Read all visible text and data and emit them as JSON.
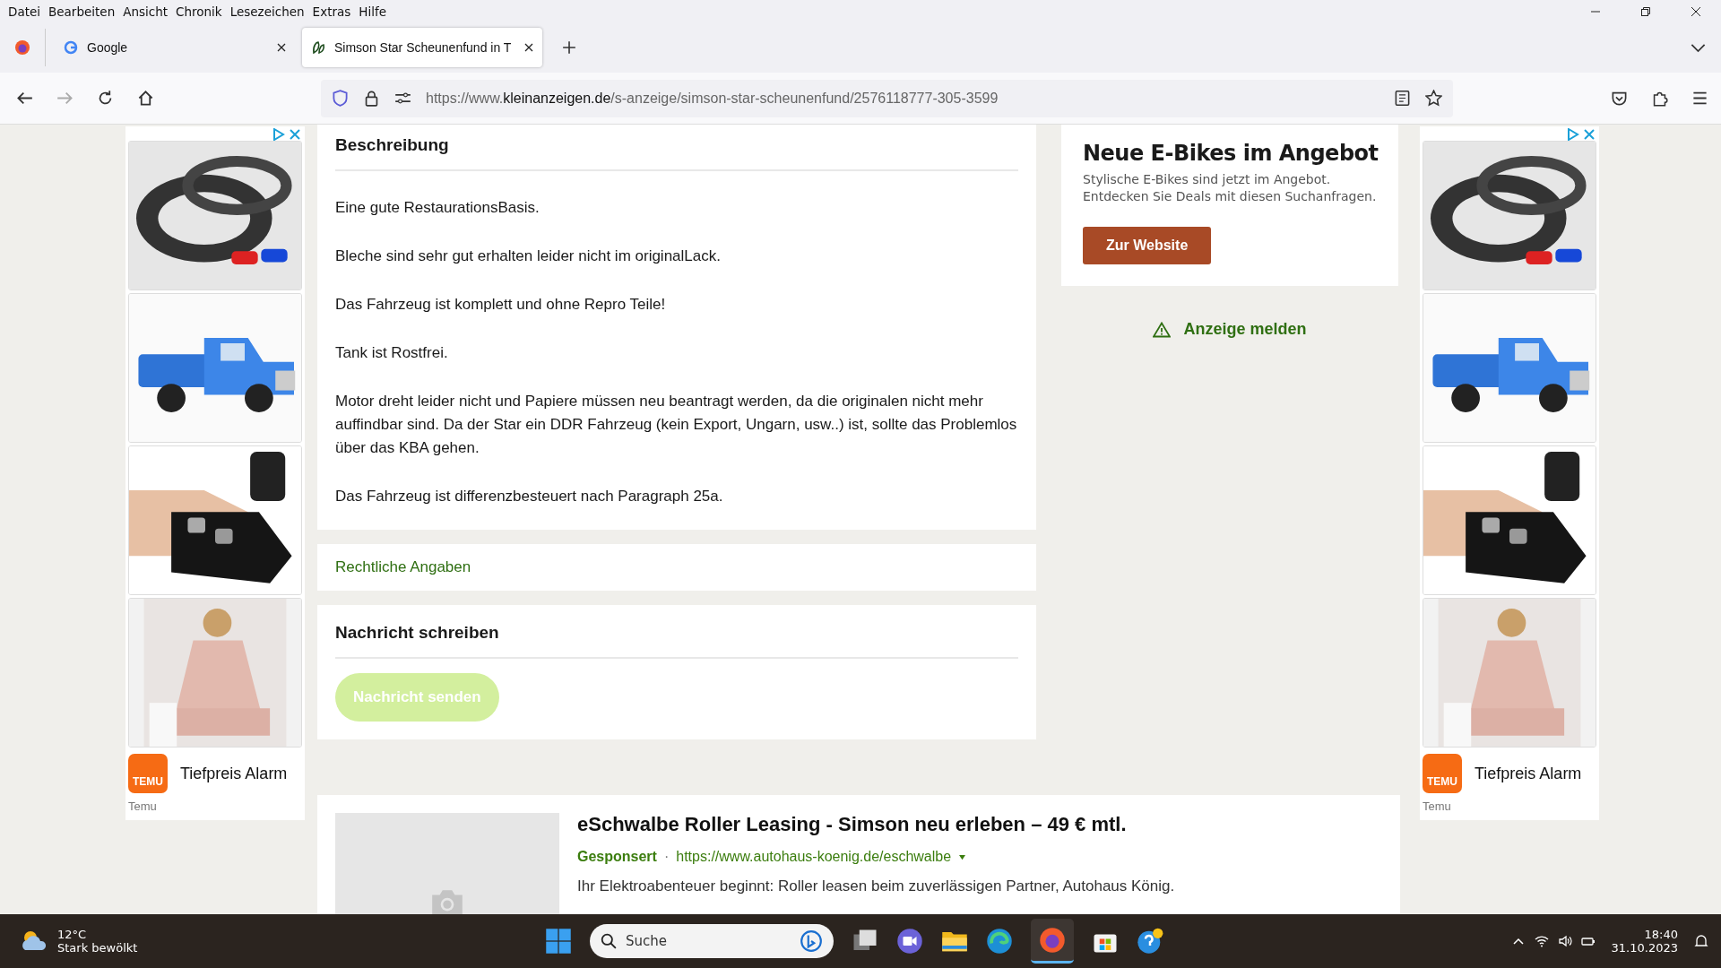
{
  "menu_bar": [
    "Datei",
    "Bearbeiten",
    "Ansicht",
    "Chronik",
    "Lesezeichen",
    "Extras",
    "Hilfe"
  ],
  "tabs": [
    {
      "label": "Google",
      "selected": false
    },
    {
      "label": "Simson Star Scheunenfund in T",
      "selected": true
    }
  ],
  "address_bar": {
    "scheme": "https://www.",
    "domain": "kleinanzeigen.de",
    "path": "/s-anzeige/simson-star-scheunenfund/2576118777-305-3599"
  },
  "left_ad": {
    "logo": "TEMU",
    "title": "Tiefpreis Alarm",
    "advertiser": "Temu"
  },
  "description": {
    "heading": "Beschreibung",
    "paragraphs": [
      "Eine gute RestaurationsBasis.",
      "Bleche sind sehr gut erhalten leider nicht im originalLack.",
      "Das Fahrzeug ist komplett und ohne Repro Teile!",
      "Tank ist Rostfrei.",
      "Motor dreht leider nicht und Papiere müssen neu beantragt werden, da die originalen nicht mehr auffindbar sind. Da der Star ein DDR Fahrzeug (kein Export, Ungarn, usw..) ist, sollte das Problemlos über das KBA gehen.",
      "Das Fahrzeug ist differenzbesteuert nach Paragraph 25a."
    ]
  },
  "legal_link": "Rechtliche Angaben",
  "message": {
    "heading": "Nachricht schreiben",
    "button": "Nachricht senden",
    "disabled": true
  },
  "right_ad": {
    "title": "Neue E-Bikes im Angebot",
    "text": "Stylische E-Bikes sind jetzt im Angebot. Entdecken Sie Deals mit diesen Suchanfragen.",
    "button": "Zur Website"
  },
  "report_link": "Anzeige melden",
  "right_side_ad": {
    "logo": "TEMU",
    "title": "Tiefpreis Alarm",
    "advertiser": "Temu"
  },
  "sponsored": {
    "title": "eSchwalbe Roller Leasing - Simson neu erleben – 49 € mtl.",
    "label": "Gesponsert",
    "separator": "·",
    "url": "https://www.autohaus-koenig.de/eschwalbe",
    "text": "Ihr Elektroabenteuer beginnt: Roller leasen beim zuverlässigen Partner, Autohaus König."
  },
  "taskbar": {
    "temperature": "12°C",
    "weather": "Stark bewölkt",
    "search": "Suche",
    "time": "18:40",
    "date": "31.10.2023"
  }
}
